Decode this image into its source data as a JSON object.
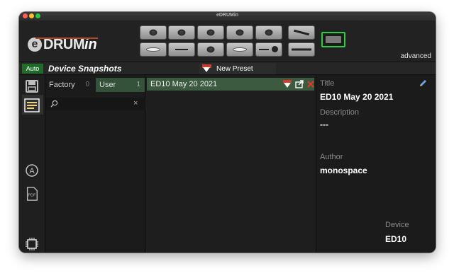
{
  "window": {
    "title": "eDRUMin"
  },
  "header": {
    "logo": {
      "prefix": "e",
      "main": "DRUM",
      "suffix": "in"
    },
    "mode_label": "advanced",
    "pads_top": [
      "drum",
      "drum",
      "drum",
      "drum",
      "drum",
      "line"
    ],
    "pads_bottom": [
      "cymbal",
      "hihat",
      "drum",
      "cymbal",
      "stick",
      "line"
    ],
    "module_icon": "midi-module-icon"
  },
  "toolbar": {
    "auto_label": "Auto",
    "section_title": "Device Snapshots",
    "new_preset_label": "New Preset"
  },
  "sidebar": {
    "icons": [
      "save-icon",
      "list-icon",
      "a-circle-icon",
      "pdf-icon",
      "chip-icon"
    ],
    "active": "list-icon"
  },
  "list_panel": {
    "tabs": [
      {
        "label": "Factory",
        "count": "0"
      },
      {
        "label": "User",
        "count": "1"
      }
    ],
    "search": {
      "value": "",
      "placeholder": ""
    }
  },
  "presets": {
    "rows": [
      {
        "name": "ED10 May 20 2021",
        "selected": true
      }
    ]
  },
  "details": {
    "title_label": "Title",
    "title_value": "ED10 May 20 2021",
    "description_label": "Description",
    "description_value": "---",
    "author_label": "Author",
    "author_value": "monospace",
    "device_label": "Device",
    "device_value": "ED10"
  },
  "colors": {
    "accent_green": "#29d142",
    "selection_green": "#3b5a3f",
    "delete_red": "#d83a2a"
  }
}
